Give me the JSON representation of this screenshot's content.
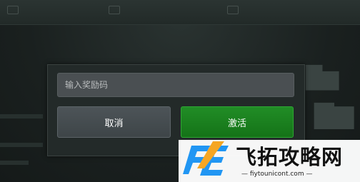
{
  "dialog": {
    "code_input": {
      "placeholder": "输入奖励码",
      "value": ""
    },
    "cancel_label": "取消",
    "activate_label": "激活"
  },
  "watermark": {
    "title": "飞拓攻略网",
    "subtitle": "fiytounicont.com",
    "logo_colors": {
      "blue": "#2196f3",
      "orange": "#f5a623"
    }
  },
  "colors": {
    "activate_green": "#1a8020",
    "cancel_gray": "#464d50",
    "input_bg": "#4a4f52"
  }
}
